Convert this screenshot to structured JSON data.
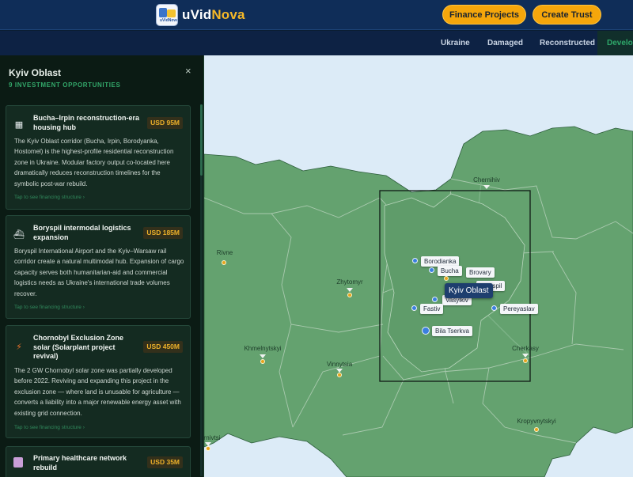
{
  "header": {
    "brand_prefix": "uVid",
    "brand_suffix": "Nova",
    "logo_icon": "uvidnova-logo",
    "finance_button": "Finance Projects",
    "trust_button": "Create Trust"
  },
  "tabs": [
    "Ukraine",
    "Damaged",
    "Reconstructed",
    "Develop"
  ],
  "sidebar": {
    "title": "Kyiv Oblast",
    "subtitle": "9 INVESTMENT OPPORTUNITIES",
    "close_icon": "×",
    "cards": [
      {
        "icon": "residential-building-icon",
        "title": "Bucha–Irpin reconstruction-era housing hub",
        "amount": "USD 95M",
        "body": "The Kyiv Oblast corridor (Bucha, Irpin, Borodyanka, Hostomel) is the highest-profile residential reconstruction zone in Ukraine. Modular factory output co-located here dramatically reduces reconstruction timelines for the symbolic post-war rebuild.",
        "link": "Tap to see financing structure ›"
      },
      {
        "icon": "cargo-ship-icon",
        "title": "Boryspil intermodal logistics expansion",
        "amount": "USD 185M",
        "body": "Boryspil International Airport and the Kyiv–Warsaw rail corridor create a natural multimodal hub. Expansion of cargo capacity serves both humanitarian-aid and commercial logistics needs as Ukraine's international trade volumes recover.",
        "link": "Tap to see financing structure ›"
      },
      {
        "icon": "lightning-icon",
        "title": "Chornobyl Exclusion Zone solar (Solarplant project revival)",
        "amount": "USD 450M",
        "body": "The 2 GW Chornobyl solar zone was partially developed before 2022. Reviving and expanding this project in the exclusion zone — where land is unusable for agriculture — converts a liability into a major renewable energy asset with existing grid connection.",
        "link": "Tap to see financing structure ›"
      },
      {
        "icon": "medical-kit-icon",
        "title": "Primary healthcare network rebuild",
        "amount": "USD 35M",
        "body": "",
        "link": ""
      }
    ]
  },
  "map": {
    "cities": [
      {
        "name": "Chernihiv"
      },
      {
        "name": "Rivne"
      },
      {
        "name": "Zhytomyr"
      },
      {
        "name": "Khmelnytskyi"
      },
      {
        "name": "Vinnytsia"
      },
      {
        "name": "Cherkasy"
      },
      {
        "name": "Kropyvnytskyi"
      },
      {
        "name": "rnivtsi"
      }
    ],
    "oblast_places": [
      "Borodianka",
      "Bucha",
      "Brovary",
      "Boryspil",
      "Vasylkiv",
      "Fastiv",
      "Pereyaslav",
      "Bila Tserkva"
    ],
    "tooltip": "Kyiv Oblast",
    "colors": {
      "land": "#64a26f",
      "border": "#a9c9ae",
      "water": "#dcebf7",
      "accent": "#f5a60b"
    }
  }
}
